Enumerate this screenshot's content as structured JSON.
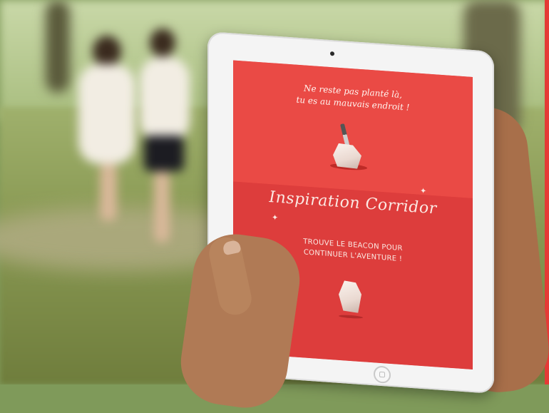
{
  "screen": {
    "tagline_line1": "Ne reste pas planté là,",
    "tagline_line2": "tu es au mauvais endroit !",
    "app_title": "Inspiration Corridor",
    "instruction_line1": "TROUVE LE BEACON POUR",
    "instruction_line2": "CONTINUER L'AVENTURE !"
  },
  "colors": {
    "screen_top": "#ea4a45",
    "screen_bottom": "#dd3d3c",
    "accent_edge": "#e43a36"
  }
}
